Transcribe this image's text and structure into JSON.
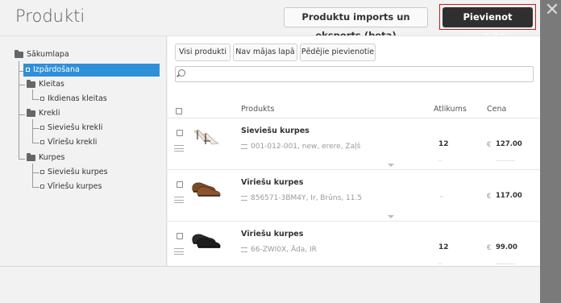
{
  "header": {
    "title": "Produkti",
    "import_button": "Produktu imports un eksports (beta)",
    "add_button": "Pievienot produktu",
    "close_icon": "close-icon"
  },
  "sidebar": {
    "tree": [
      {
        "label": "Sākumlapa",
        "icon": "folder-icon",
        "level": 0
      },
      {
        "label": "Izpārdošana",
        "icon": "leaf-icon",
        "level": 1,
        "selected": true
      },
      {
        "label": "Kleitas",
        "icon": "folder-icon",
        "level": 1
      },
      {
        "label": "Ikdienas kleitas",
        "icon": "leaf-icon",
        "level": 2
      },
      {
        "label": "Krekli",
        "icon": "folder-icon",
        "level": 1
      },
      {
        "label": "Sieviešu krekli",
        "icon": "leaf-icon",
        "level": 2
      },
      {
        "label": "Vīriešu krekli",
        "icon": "leaf-icon",
        "level": 2
      },
      {
        "label": "Kurpes",
        "icon": "folder-icon",
        "level": 1
      },
      {
        "label": "Sieviešu kurpes",
        "icon": "leaf-icon",
        "level": 2
      },
      {
        "label": "Vīriešu kurpes",
        "icon": "leaf-icon",
        "level": 2
      }
    ],
    "selected_color": "#2f8fd9"
  },
  "tabs": [
    "Visi produkti",
    "Nav mājas lapā",
    "Pēdējie pievienotie"
  ],
  "search": {
    "placeholder": ""
  },
  "table": {
    "columns": {
      "product": "Produkts",
      "stock": "Atlikums",
      "price": "Cena"
    },
    "rows": [
      {
        "name": "Sieviešu kurpes",
        "meta": "001-012-001, new, erere, Zaļš",
        "stock": "12",
        "currency": "€",
        "price": "127.00",
        "thumb": "women-heels-image"
      },
      {
        "name": "Vīriešu kurpes",
        "meta": "856571-3BM4Y, Ir, Brūns, 11.5",
        "stock": "",
        "currency": "€",
        "price": "117.00",
        "thumb": "brown-shoes-image"
      },
      {
        "name": "Vīriešu kurpes",
        "meta": "66-ZWI0X, Āda, IR",
        "stock": "12",
        "currency": "€",
        "price": "99.00",
        "thumb": "black-shoes-image"
      }
    ]
  }
}
